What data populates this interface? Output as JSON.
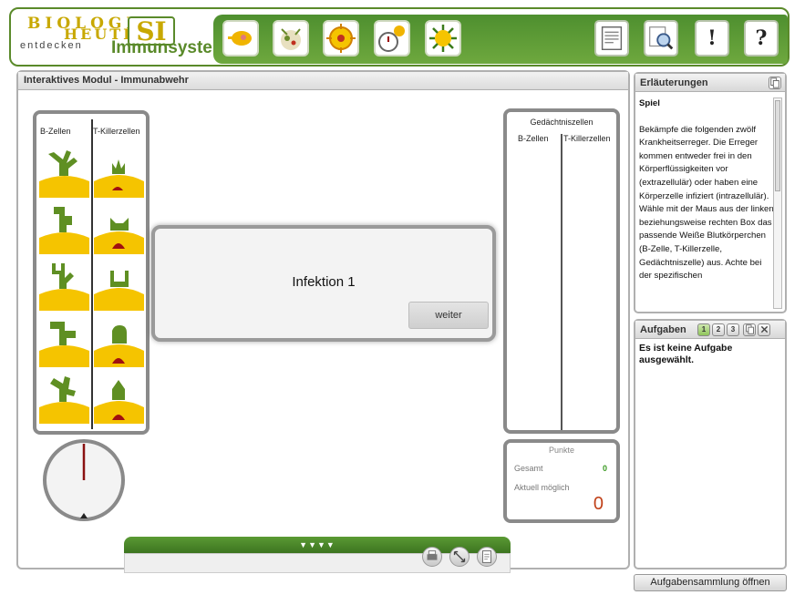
{
  "header": {
    "logo_line1": "BIOLOGIE",
    "logo_line2": "HEUTE",
    "logo_si": "SI",
    "logo_entdecken": "entdecken",
    "logo_subject": "Immunsystem",
    "right_buttons": [
      {
        "icon": "document-icon"
      },
      {
        "icon": "magnifier-icon"
      },
      {
        "icon": "exclamation-icon",
        "glyph": "!"
      },
      {
        "icon": "question-icon",
        "glyph": "?"
      }
    ]
  },
  "main": {
    "title": "Interaktives Modul - Immunabwehr",
    "left_panel": {
      "col1": "B-Zellen",
      "col2": "T-Killerzellen"
    },
    "right_panel": {
      "title": "Gedächtniszellen",
      "col1": "B-Zellen",
      "col2": "T-Killerzellen"
    },
    "score": {
      "title": "Punkte",
      "total_label": "Gesamt",
      "total_value": "0",
      "possible_label": "Aktuell möglich",
      "possible_value": "0"
    },
    "modal": {
      "title": "Infektion 1",
      "button": "weiter"
    },
    "drawer": {
      "toggle": "▼▼▼▼"
    }
  },
  "sidebar": {
    "erlaeuterungen": {
      "title": "Erläuterungen",
      "heading": "Spiel",
      "text": "Bekämpfe die folgenden zwölf Krankheitserreger. Die Erreger kommen entweder frei in den Körperflüssigkeiten vor (extrazellulär) oder haben eine Körperzelle infiziert (intrazellulär). Wähle mit der Maus aus der linken beziehungsweise rechten Box das passende Weiße Blutkörperchen (B-Zelle, T-Killerzelle, Gedächtniszelle) aus. Achte bei der spezifischen"
    },
    "aufgaben": {
      "title": "Aufgaben",
      "buttons": [
        "1",
        "2",
        "3"
      ],
      "empty": "Es ist keine Aufgabe ausgewählt."
    },
    "open_button": "Aufgabensammlung öffnen"
  },
  "colors": {
    "brand_green": "#5a8a2a",
    "cell_yellow": "#f5c400",
    "receptor_green": "#5f8f23",
    "nucleus_red": "#a01010"
  }
}
